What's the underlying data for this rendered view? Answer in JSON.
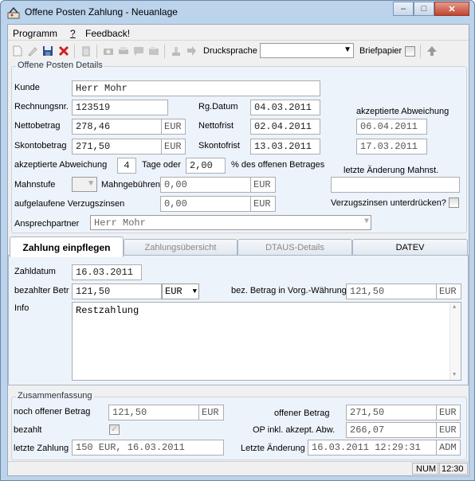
{
  "window": {
    "title": "Offene Posten Zahlung - Neuanlage",
    "min": "‒",
    "max": "□",
    "close": "✕"
  },
  "menu": {
    "programm": "Programm",
    "help": "?",
    "feedback": "Feedback!"
  },
  "toolbar": {
    "druckschrift_label": "Drucksprache",
    "druckschrift_value": "",
    "briefpapier_label": "Briefpapier"
  },
  "details": {
    "title": "Offene Posten Details",
    "kunde_label": "Kunde",
    "kunde_value": "Herr Mohr",
    "rechnungsnr_label": "Rechnungsnr.",
    "rechnungsnr_value": "123519",
    "rgdatum_label": "Rg.Datum",
    "rgdatum_value": "04.03.2011",
    "akz_abw_header": "akzeptierte Abweichung",
    "nettobetrag_label": "Nettobetrag",
    "nettobetrag_value": "278,46",
    "nettobetrag_unit": "EUR",
    "nettofrist_label": "Nettofrist",
    "nettofrist_value": "02.04.2011",
    "nettofrist_abw": "06.04.2011",
    "skontobetrag_label": "Skontobetrag",
    "skontobetrag_value": "271,50",
    "skontobetrag_unit": "EUR",
    "skontofrist_label": "Skontofrist",
    "skontofrist_value": "13.03.2011",
    "skontofrist_abw": "17.03.2011",
    "akz_abw_label": "akzeptierte Abweichung",
    "akz_abw_tage": "4",
    "tage_oder": "Tage oder",
    "akz_abw_prozent": "2,00",
    "prozent_label": "% des offenen Betrages",
    "letzte_mahn_label": "letzte Änderung Mahnst.",
    "letzte_mahn_value": "",
    "mahnstufe_label": "Mahnstufe",
    "mahnstufe_value": "",
    "mahngebuehren_label": "Mahngebühren",
    "mahngebuehren_value": "0,00",
    "mahngebuehren_unit": "EUR",
    "verzugszinsen_label": "aufgelaufene Verzugszinsen",
    "verzugszinsen_value": "0,00",
    "verzugszinsen_unit": "EUR",
    "unterdruecken_label": "Verzugszinsen unterdrücken?",
    "ansprechpartner_label": "Ansprechpartner",
    "ansprechpartner_value": "Herr Mohr"
  },
  "tabs": {
    "t1": "Zahlung einpflegen",
    "t2": "Zahlungsübersicht",
    "t3": "DTAUS-Details",
    "t4": "DATEV"
  },
  "payment": {
    "zahldatum_label": "Zahldatum",
    "zahldatum_value": "16.03.2011",
    "bezahlt_label": "bezahlter Betr",
    "bezahlt_value": "121,50",
    "currency": "EUR",
    "vorg_label": "bez. Betrag in Vorg.-Währung",
    "vorg_value": "121,50",
    "vorg_unit": "EUR",
    "info_label": "Info",
    "info_value": "Restzahlung"
  },
  "summary": {
    "title": "Zusammenfassung",
    "noch_offen_label": "noch offener Betrag",
    "noch_offen_value": "121,50",
    "noch_offen_unit": "EUR",
    "offener_label": "offener Betrag",
    "offener_value": "271,50",
    "offener_unit": "EUR",
    "bezahlt_label": "bezahlt",
    "op_label": "OP inkl. akzept. Abw.",
    "op_value": "266,07",
    "op_unit": "EUR",
    "letzte_zahlung_label": "letzte Zahlung",
    "letzte_zahlung_value": "150 EUR, 16.03.2011",
    "letzte_aenderung_label": "Letzte Änderung",
    "letzte_aenderung_value": "16.03.2011 12:29:31",
    "letzte_aenderung_user": "ADM"
  },
  "status": {
    "num": "NUM",
    "time": "12:30"
  }
}
